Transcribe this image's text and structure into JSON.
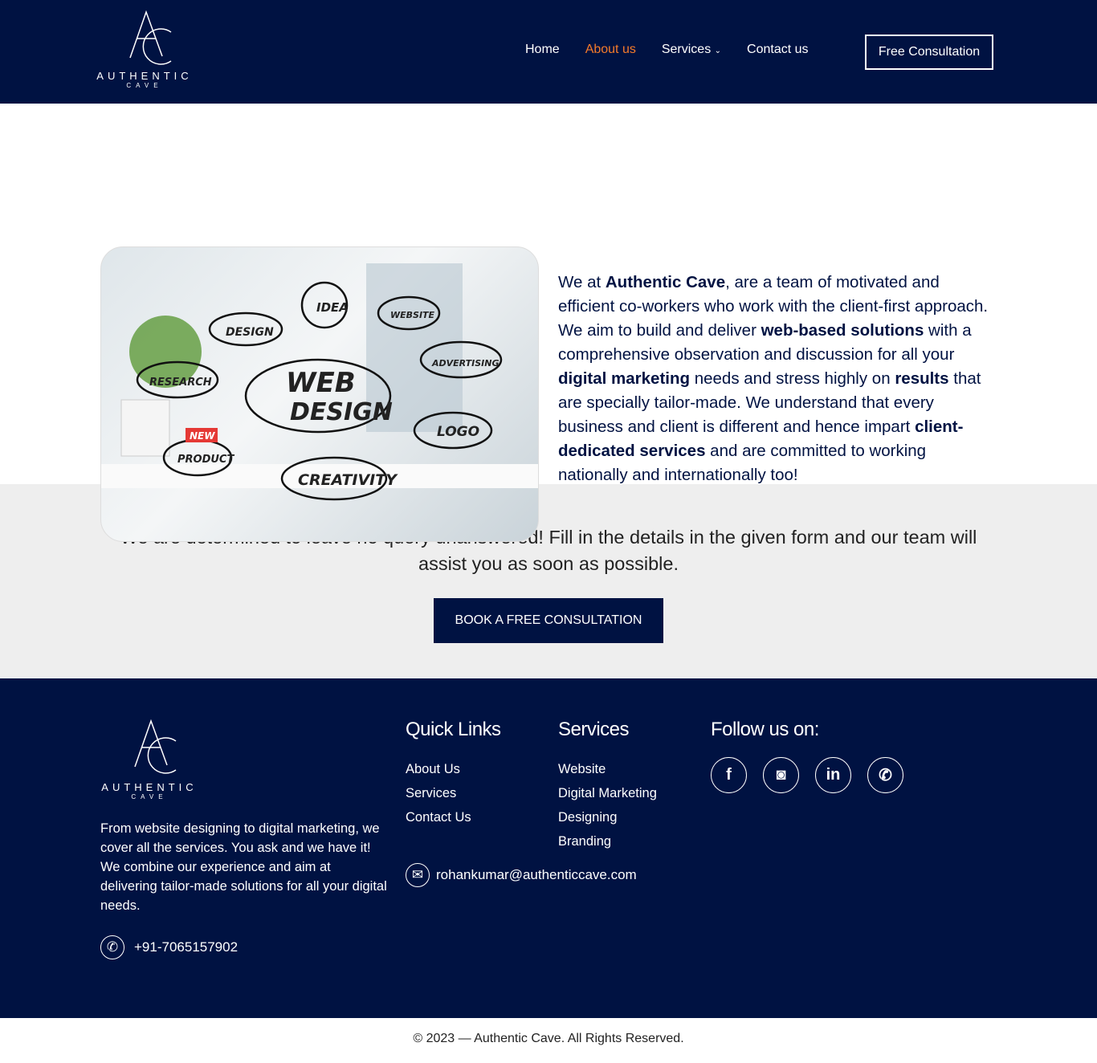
{
  "brand": {
    "name": "AUTHENTIC",
    "sub": "CAVE"
  },
  "nav": {
    "items": [
      "Home",
      "About us",
      "Services",
      "Contact us"
    ],
    "cta": "Free Consultation"
  },
  "hero_image": {
    "labels": [
      "IDEA",
      "WEBSITE",
      "DESIGN",
      "RESEARCH",
      "ADVERTISING",
      "WEB",
      "DESIGN",
      "NEW",
      "PRODUCT",
      "LOGO",
      "CREATIVITY"
    ]
  },
  "about": {
    "p": [
      "We at ",
      "Authentic Cave",
      ", are a team of motivated and efficient co-workers who work with the client-first approach. We aim to build and deliver ",
      "web-based solutions",
      " with a comprehensive observation and discussion for all your ",
      "digital marketing",
      " needs and stress highly on ",
      "results",
      " that are specially tailor-made. We understand that every business and client is different and hence impart ",
      "client-dedicated services",
      " and are committed to working nationally and internationally too!"
    ]
  },
  "band": {
    "text": "We are determined to leave no query unanswered! Fill in the details in the given form and our team will assist you as soon as possible.",
    "button": "BOOK A FREE CONSULTATION"
  },
  "footer": {
    "desc": "From website designing to digital marketing, we cover all the services. You ask and we have it! We combine our experience and aim at delivering tailor-made solutions for all your digital needs.",
    "phone": "+91-7065157902",
    "quick": {
      "title": "Quick Links",
      "items": [
        "About Us",
        "Services",
        "Contact Us"
      ]
    },
    "services": {
      "title": "Services",
      "items": [
        "Website",
        "Digital Marketing",
        "Designing",
        "Branding"
      ]
    },
    "email": "rohankumar@authenticcave.com",
    "follow": {
      "title": "Follow us on:",
      "icons": [
        "facebook-icon",
        "instagram-icon",
        "linkedin-icon",
        "whatsapp-icon"
      ],
      "glyphs": [
        "f",
        "◙",
        "in",
        "✆"
      ]
    }
  },
  "copyright": "© 2023 — Authentic Cave. All Rights Reserved.",
  "colors": {
    "navy": "#001242",
    "accent": "#f47b2a"
  }
}
